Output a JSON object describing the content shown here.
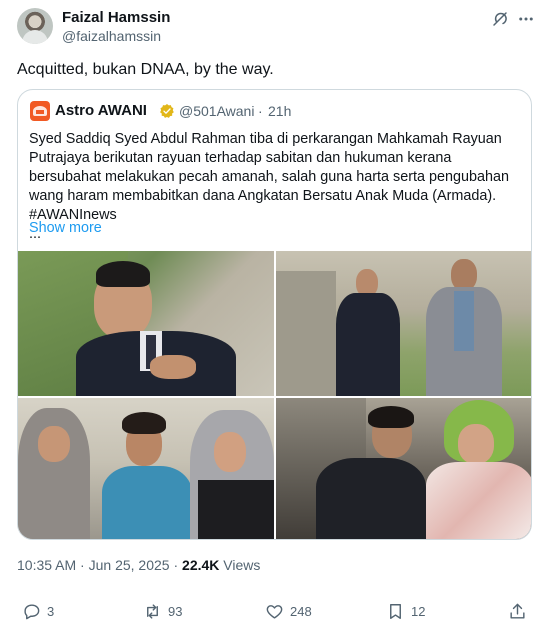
{
  "author": {
    "display_name": "Faizal Hamssin",
    "handle": "@faizalhamssin"
  },
  "tweet": {
    "text": "Acquitted, bukan DNAA, by the way."
  },
  "quote": {
    "display_name": "Astro AWANI",
    "handle": "@501Awani",
    "separator": "·",
    "time": "21h",
    "text": "Syed Saddiq Syed Abdul Rahman tiba di perkarangan Mahkamah Rayuan Putrajaya berikutan rayuan terhadap sabitan dan hukuman kerana bersubahat melakukan pecah amanah, salah guna harta serta pengubahan wang haram membabitkan dana Angkatan Bersatu Anak Muda (Armada). #AWANInews\n...",
    "show_more": "Show more"
  },
  "meta": {
    "time": "10:35 AM",
    "separator": " · ",
    "date": "Jun 25, 2025",
    "views_count": "22.4K",
    "views_label": " Views"
  },
  "actions": {
    "replies": "3",
    "reposts": "93",
    "likes": "248",
    "bookmarks": "12"
  },
  "colors": {
    "text": "#0f1419",
    "secondary": "#536471",
    "link": "#1d9bf0",
    "border": "#cfd9de",
    "verified_gold": "#e2b719",
    "awani_orange": "#f15a24"
  },
  "icons": [
    "grok-icon",
    "more-icon",
    "verified-icon",
    "reply-icon",
    "repost-icon",
    "like-icon",
    "bookmark-icon",
    "share-icon"
  ]
}
